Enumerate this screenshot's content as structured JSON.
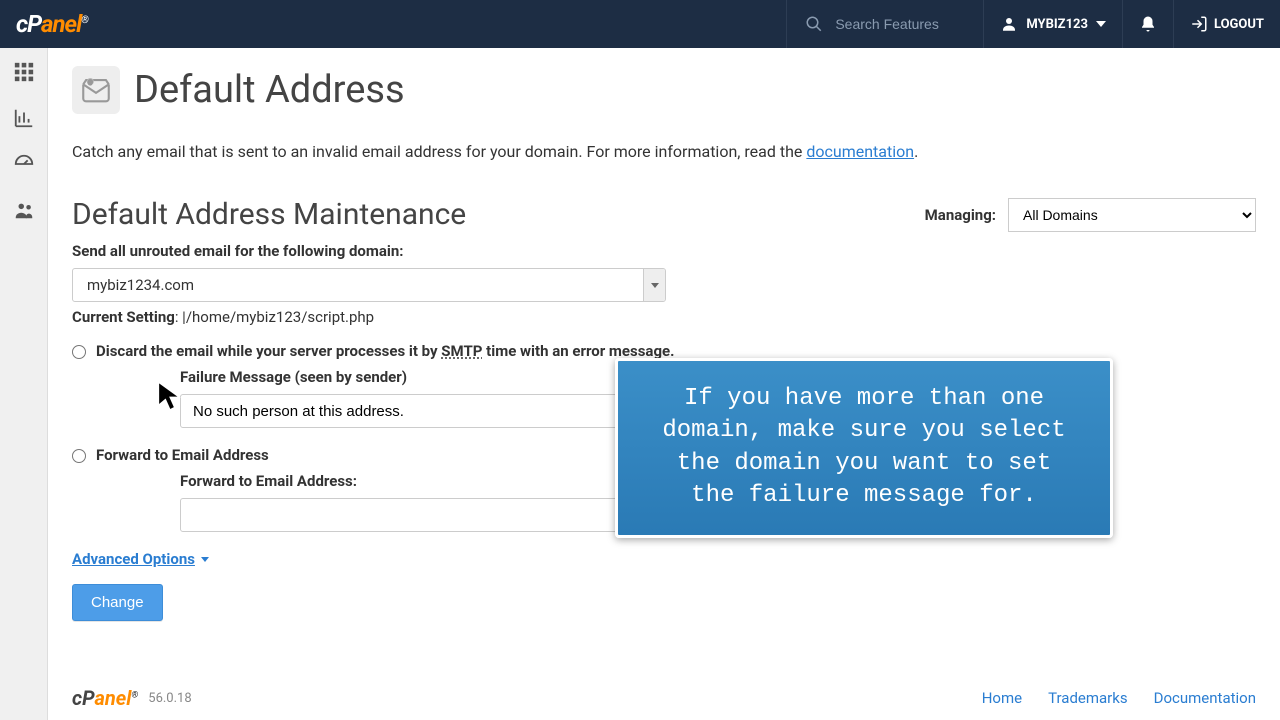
{
  "header": {
    "search_placeholder": "Search Features",
    "username": "MYBIZ123",
    "logout_label": "LOGOUT"
  },
  "page": {
    "title": "Default Address",
    "intro_pre": "Catch any email that is sent to an invalid email address for your domain. For more information, read the ",
    "intro_link": "documentation",
    "intro_post": "."
  },
  "section": {
    "title": "Default Address Maintenance",
    "managing_label": "Managing:",
    "managing_value": "All Domains",
    "domain_label": "Send all unrouted email for the following domain:",
    "domain_value": "mybiz1234.com",
    "current_setting_label": "Current Setting",
    "current_setting_value": "|/home/mybiz123/script.php",
    "option_discard_pre": "Discard the email while your server processes it by ",
    "option_discard_smtp": "SMTP",
    "option_discard_post": " time with an error message.",
    "failure_label": "Failure Message (seen by sender)",
    "failure_value": "No such person at this address.",
    "option_forward": "Forward to Email Address",
    "forward_label": "Forward to Email Address:",
    "forward_value": "",
    "advanced_label": "Advanced Options",
    "change_label": "Change"
  },
  "footer": {
    "version": "56.0.18",
    "links": [
      "Home",
      "Trademarks",
      "Documentation"
    ]
  },
  "callout": {
    "text": "If you have more than one domain, make sure you select the domain you want to set the failure message for."
  }
}
